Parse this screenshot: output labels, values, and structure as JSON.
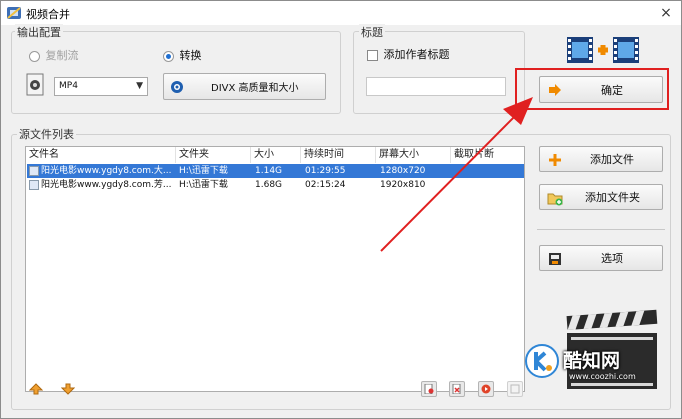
{
  "window": {
    "title": "视频合并",
    "close_label": "×"
  },
  "output_config": {
    "legend": "输出配置",
    "copy_stream_label": "复制流",
    "convert_label": "转换",
    "format_value": "MP4",
    "quality_label": "DIVX 高质量和大小"
  },
  "title_group": {
    "legend": "标题",
    "add_author_title_label": "添加作者标题",
    "title_value": ""
  },
  "confirm_label": "确定",
  "source_list": {
    "legend": "源文件列表",
    "columns": [
      "文件名",
      "文件夹",
      "大小",
      "持续时间",
      "屏幕大小",
      "截取片断"
    ],
    "rows": [
      {
        "name": "阳光电影www.ygdy8.com.大...",
        "folder": "H:\\迅雷下载",
        "size": "1.14G",
        "duration": "01:29:55",
        "screen": "1280x720",
        "clip": "",
        "selected": true
      },
      {
        "name": "阳光电影www.ygdy8.com.芳...",
        "folder": "H:\\迅雷下载",
        "size": "1.68G",
        "duration": "02:15:24",
        "screen": "1920x810",
        "clip": "",
        "selected": false
      }
    ]
  },
  "side_buttons": {
    "add_file": "添加文件",
    "add_folder": "添加文件夹",
    "options": "选项"
  },
  "watermark": {
    "brand": "酷知网",
    "url": "www.coozhi.com"
  },
  "colors": {
    "accent": "#3478d6",
    "annotation": "#e02020"
  }
}
